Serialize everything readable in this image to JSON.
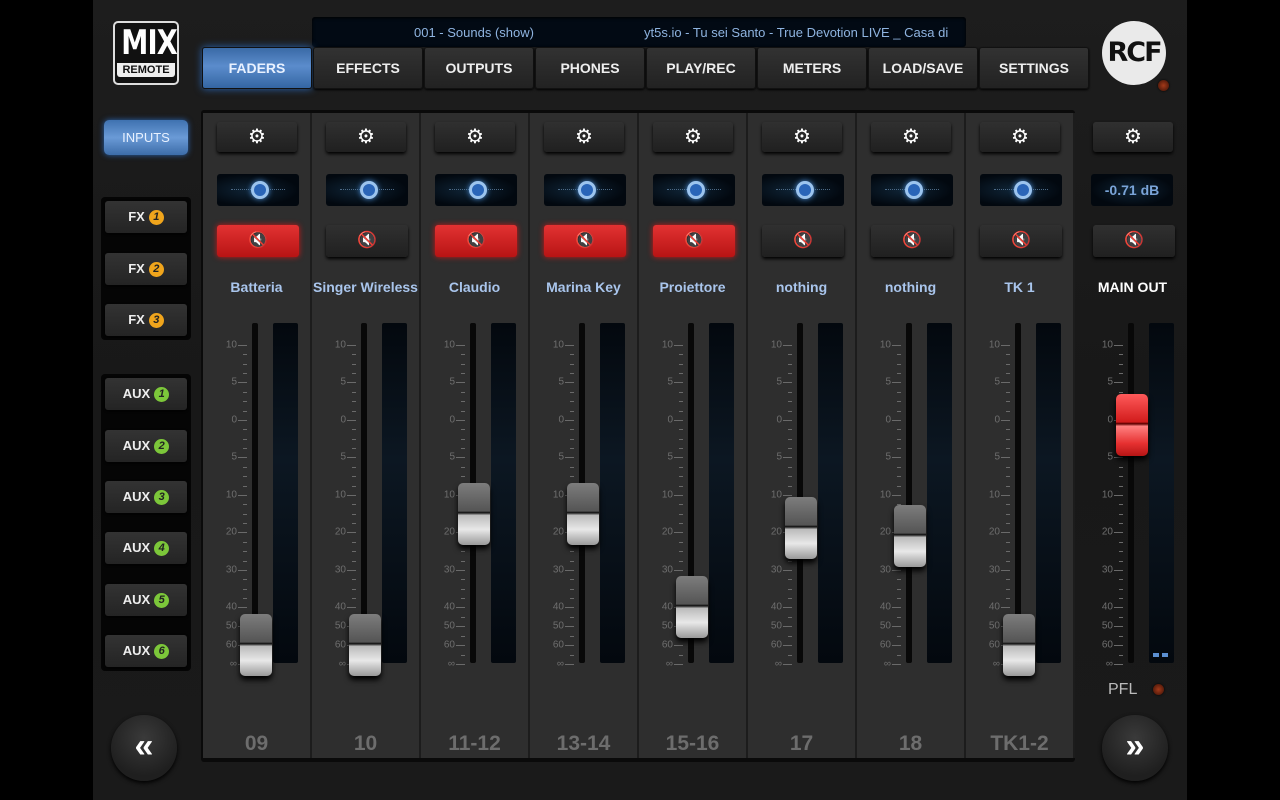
{
  "app": {
    "logo_top": "MIX",
    "logo_bottom": "REMOTE",
    "brand": "RCF"
  },
  "now_playing": {
    "scene": "001 - Sounds (show)",
    "track": "yt5s.io - Tu sei Santo - True Devotion LIVE _ Casa di"
  },
  "tabs": [
    {
      "label": "FADERS",
      "active": true
    },
    {
      "label": "EFFECTS",
      "active": false
    },
    {
      "label": "OUTPUTS",
      "active": false
    },
    {
      "label": "PHONES",
      "active": false
    },
    {
      "label": "PLAY/REC",
      "active": false
    },
    {
      "label": "METERS",
      "active": false
    },
    {
      "label": "LOAD/SAVE",
      "active": false
    },
    {
      "label": "SETTINGS",
      "active": false
    }
  ],
  "sidebar": {
    "inputs_label": "INPUTS",
    "fx": [
      {
        "label": "FX",
        "num": "1"
      },
      {
        "label": "FX",
        "num": "2"
      },
      {
        "label": "FX",
        "num": "3"
      }
    ],
    "aux": [
      {
        "label": "AUX",
        "num": "1"
      },
      {
        "label": "AUX",
        "num": "2"
      },
      {
        "label": "AUX",
        "num": "3"
      },
      {
        "label": "AUX",
        "num": "4"
      },
      {
        "label": "AUX",
        "num": "5"
      },
      {
        "label": "AUX",
        "num": "6"
      }
    ]
  },
  "scale_labels": [
    "10",
    "5",
    "0",
    "5",
    "10",
    "20",
    "30",
    "40",
    "50",
    "60",
    "∞"
  ],
  "channels": [
    {
      "name": "Batteria",
      "number": "09",
      "muted": true,
      "pan": 0,
      "fader_db": -60
    },
    {
      "name": "Singer Wireless",
      "number": "10",
      "muted": false,
      "pan": 0,
      "fader_db": -60
    },
    {
      "name": "Claudio",
      "number": "11-12",
      "muted": true,
      "pan": 0,
      "fader_db": -15
    },
    {
      "name": "Marina Key",
      "number": "13-14",
      "muted": true,
      "pan": 0,
      "fader_db": -15
    },
    {
      "name": "Proiettore",
      "number": "15-16",
      "muted": true,
      "pan": 0,
      "fader_db": -40
    },
    {
      "name": "nothing",
      "number": "17",
      "muted": false,
      "pan": 0,
      "fader_db": -19
    },
    {
      "name": "nothing",
      "number": "18",
      "muted": false,
      "pan": 0,
      "fader_db": -21
    },
    {
      "name": "TK 1",
      "number": "TK1-2",
      "muted": false,
      "pan": 0,
      "fader_db": -60
    }
  ],
  "main_out": {
    "name": "MAIN OUT",
    "level_readout": "-0.71 dB",
    "fader_db": -0.71,
    "muted": false,
    "pfl_label": "PFL"
  },
  "icons": {
    "gear": "⚙",
    "mute": "🔇",
    "prev": "«",
    "next": "»"
  }
}
